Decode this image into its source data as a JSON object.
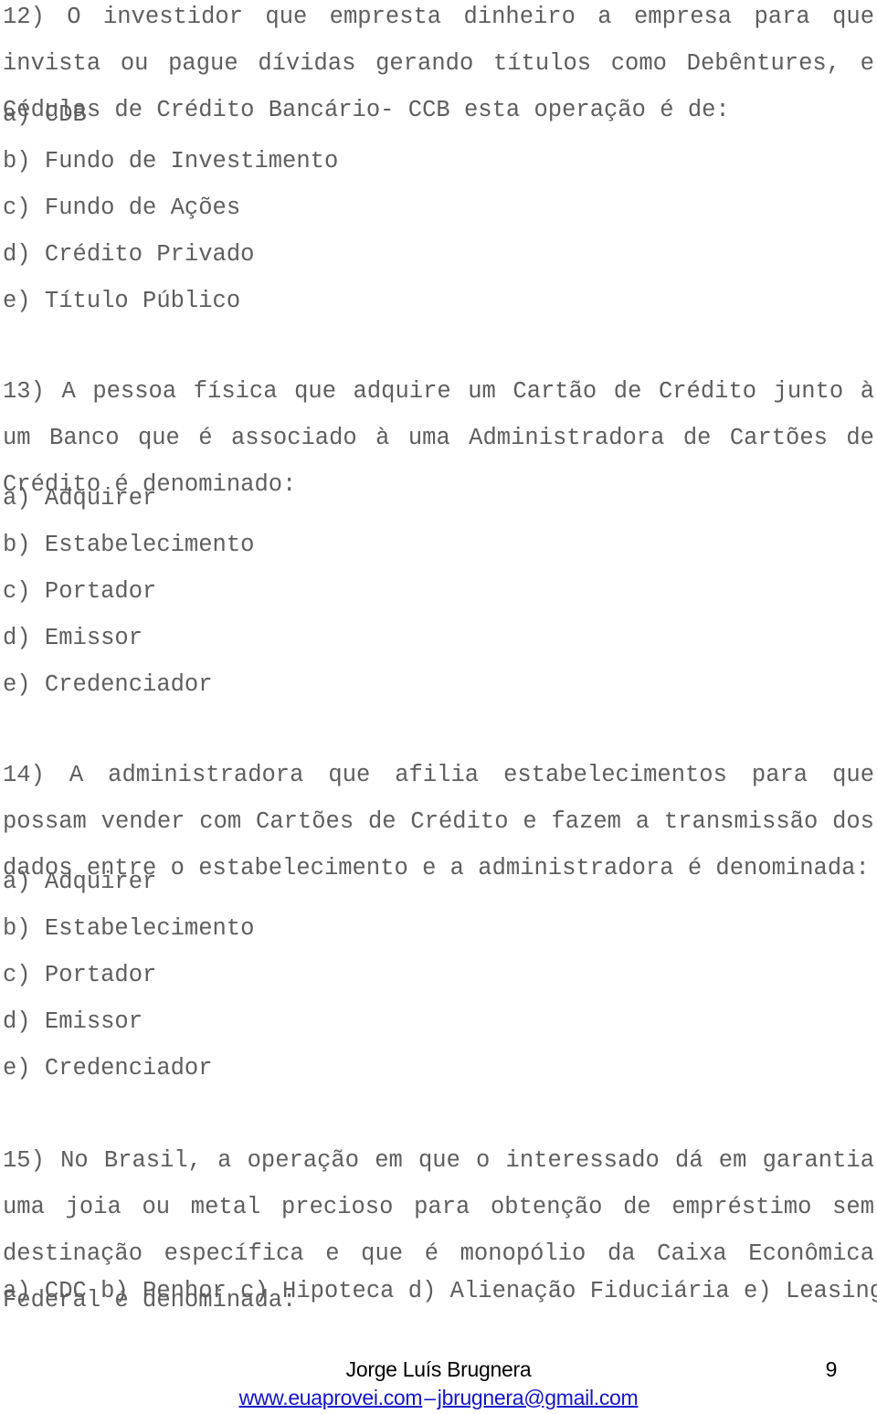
{
  "document": {
    "page_number": "9",
    "questions": [
      {
        "id": "q12",
        "stem": "12) O investidor que empresta dinheiro a empresa para que invista ou pague dívidas gerando títulos como Debêntures, e Cédulas de Crédito Bancário- CCB esta operação é de:",
        "options": [
          "a) CDB",
          "b) Fundo de Investimento",
          "c) Fundo de Ações",
          "d) Crédito Privado",
          "e) Título Público"
        ]
      },
      {
        "id": "q13",
        "stem": "13) A pessoa física que adquire um Cartão de Crédito junto à um Banco que é associado à uma Administradora de Cartões de Crédito é denominado:",
        "options": [
          "a) Adquirer",
          "b) Estabelecimento",
          "c) Portador",
          "d) Emissor",
          "e) Credenciador"
        ]
      },
      {
        "id": "q14",
        "stem": "14) A administradora que afilia estabelecimentos para que possam vender com Cartões de Crédito e fazem a transmissão dos dados entre o estabelecimento e a administradora é denominada:",
        "options": [
          "a) Adquirer",
          "b) Estabelecimento",
          "c) Portador",
          "d) Emissor",
          "e) Credenciador"
        ]
      },
      {
        "id": "q15",
        "stem": "15) No Brasil, a operação em que o interessado dá em garantia uma joia ou metal precioso para obtenção de empréstimo sem destinação específica e que é monopólio da Caixa Econômica Federal é denominada:",
        "options": [
          "a) CDC b) Penhor c) Hipoteca d) Alienação Fiduciária e) Leasing"
        ]
      }
    ]
  },
  "footer": {
    "author": "Jorge Luís Brugnera",
    "website": "www.euaprovei.com",
    "separator": "–",
    "email": "jbrugnera@gmail.com"
  },
  "colors": {
    "body_text": "#5e5e5e",
    "link": "#1414c8",
    "footer_text": "#000000",
    "background": "#ffffff"
  }
}
